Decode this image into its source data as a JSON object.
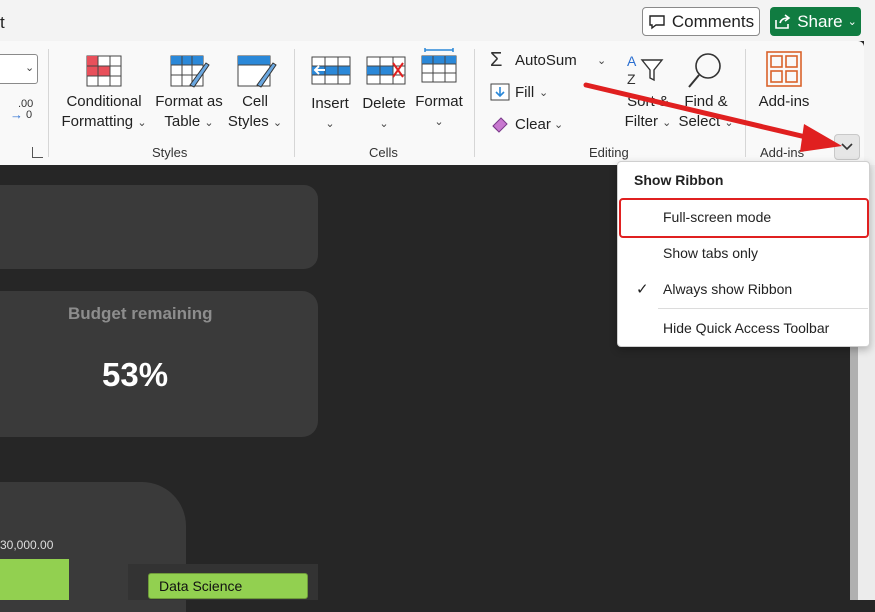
{
  "titlebar": {
    "title_fragment": "t"
  },
  "header": {
    "comments_label": "Comments",
    "share_label": "Share"
  },
  "ribbon": {
    "number_group": {
      "decimal_label_top": ".00",
      "decimal_label_bottom": "0"
    },
    "styles": {
      "conditional_formatting": [
        "Conditional",
        "Formatting"
      ],
      "format_as_table": [
        "Format as",
        "Table"
      ],
      "cell_styles": [
        "Cell",
        "Styles"
      ],
      "group_label": "Styles"
    },
    "cells": {
      "insert": "Insert",
      "delete": "Delete",
      "format": "Format",
      "group_label": "Cells"
    },
    "editing": {
      "autosum": "AutoSum",
      "fill": "Fill",
      "clear": "Clear",
      "sort_filter": [
        "Sort &",
        "Filter"
      ],
      "find_select": [
        "Find &",
        "Select"
      ],
      "group_label": "Editing"
    },
    "addins": {
      "addins": "Add-ins",
      "group_label": "Add-ins"
    }
  },
  "dashboard": {
    "budget_label": "Budget remaining",
    "budget_value": "53%",
    "axis_value": "30,000.00",
    "legend_item": "Data Science",
    "accent_green": "#92d050"
  },
  "ribbon_menu": {
    "title": "Show Ribbon",
    "items": [
      {
        "label": "Full-screen mode",
        "checked": false,
        "highlighted": true
      },
      {
        "label": "Show tabs only",
        "checked": false
      },
      {
        "label": "Always show Ribbon",
        "checked": true
      },
      {
        "label": "Hide Quick Access Toolbar",
        "checked": false
      }
    ]
  },
  "colors": {
    "share_green": "#107c41",
    "annotation_red": "#e02020"
  }
}
